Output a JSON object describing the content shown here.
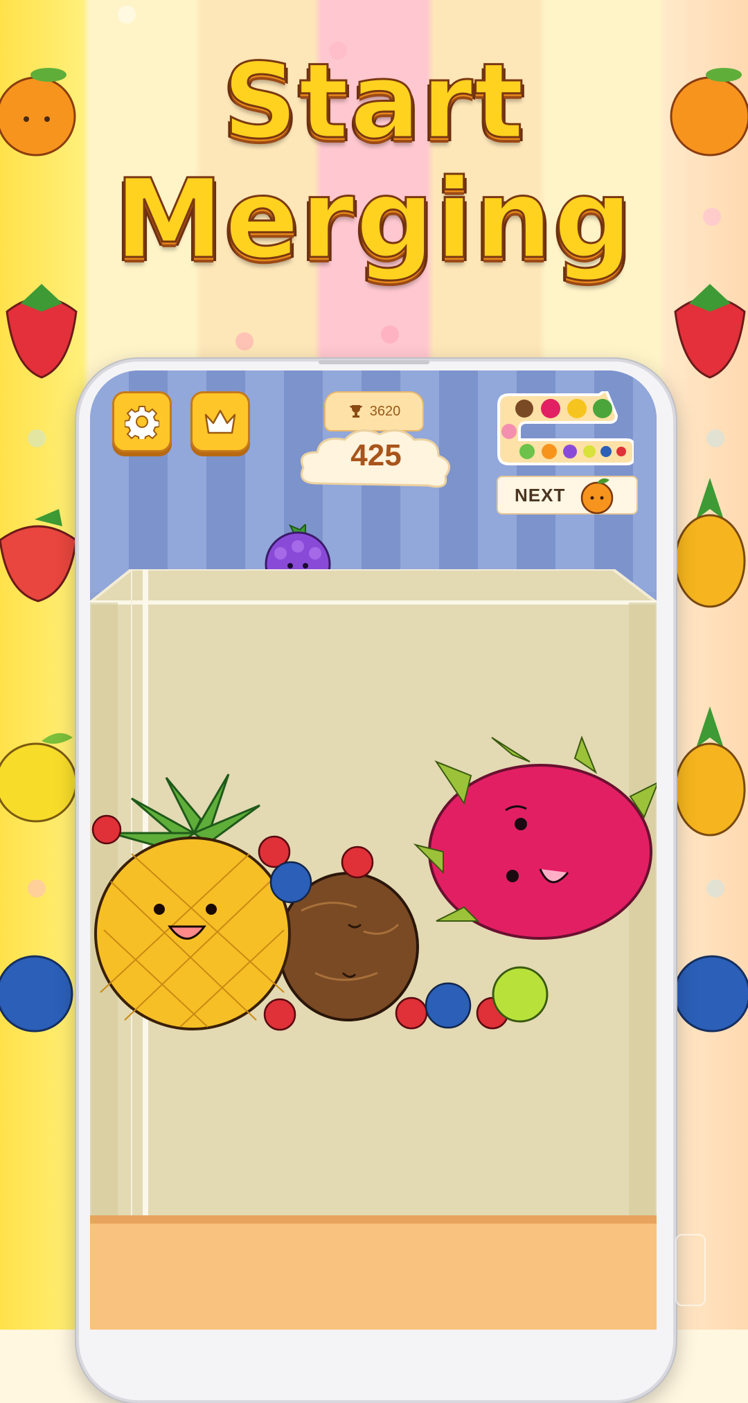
{
  "headline": {
    "line1": "Start",
    "line2": "Merging"
  },
  "hud": {
    "best_score": "3620",
    "current_score": "425",
    "next_label": "NEXT"
  },
  "icons": {
    "settings": "gear-icon",
    "leaderboard": "crown-icon",
    "best": "trophy-icon"
  },
  "evolution_chain": [
    "cherry",
    "blueberry",
    "lemon",
    "grape",
    "orange",
    "lime",
    "peach",
    "coconut",
    "dragonfruit",
    "pineapple",
    "watermelon"
  ],
  "current_drop": "grape",
  "next_fruit": "orange",
  "colors": {
    "title_fill": "#ffd21f",
    "title_outline": "#7a3811",
    "button": "#ffc629",
    "score_text": "#a8541a"
  }
}
